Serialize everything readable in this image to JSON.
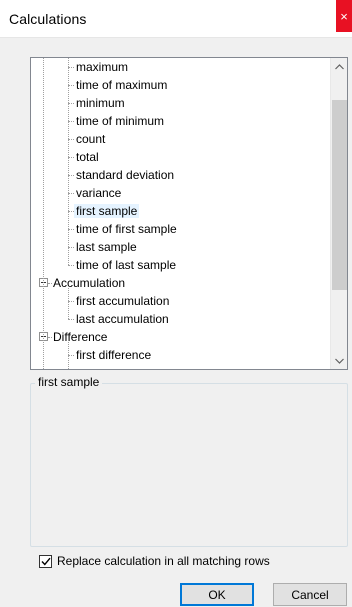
{
  "window": {
    "title": "Calculations",
    "close_glyph": "×"
  },
  "tree": {
    "items": [
      {
        "label": "maximum",
        "level": 1
      },
      {
        "label": "time of maximum",
        "level": 1
      },
      {
        "label": "minimum",
        "level": 1
      },
      {
        "label": "time of minimum",
        "level": 1
      },
      {
        "label": "count",
        "level": 1
      },
      {
        "label": "total",
        "level": 1
      },
      {
        "label": "standard deviation",
        "level": 1
      },
      {
        "label": "variance",
        "level": 1
      },
      {
        "label": "first sample",
        "level": 1,
        "selected": true
      },
      {
        "label": "time of first sample",
        "level": 1
      },
      {
        "label": "last sample",
        "level": 1
      },
      {
        "label": "time of last sample",
        "level": 1
      },
      {
        "label": "Accumulation",
        "level": 0,
        "expanded": true
      },
      {
        "label": "first accumulation",
        "level": 1
      },
      {
        "label": "last accumulation",
        "level": 1
      },
      {
        "label": "Difference",
        "level": 0,
        "expanded": true
      },
      {
        "label": "first difference",
        "level": 1
      }
    ]
  },
  "description": {
    "title": "first sample"
  },
  "options": {
    "replace_all_label": "Replace calculation in all matching rows",
    "replace_all_checked": true
  },
  "buttons": {
    "ok": "OK",
    "cancel": "Cancel"
  },
  "colors": {
    "selection": "#e5f3ff",
    "close": "#e81123",
    "default_button_border": "#0078d7"
  }
}
